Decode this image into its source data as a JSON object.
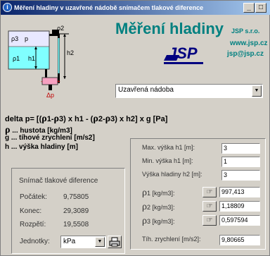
{
  "window": {
    "title": "Měření hladiny v uzavřené nádobě snímačem tlakové diference",
    "icon": "app-icon",
    "buttons": [
      "minimize-icon",
      "maximize-icon"
    ]
  },
  "diagram": {
    "labels": {
      "rho3": "ρ3",
      "p": "p",
      "rho1": "ρ1",
      "rho2": "ρ2",
      "h1": "h1",
      "h2": "h2",
      "minus": "-",
      "plus": "+",
      "delta_p": "Δp"
    }
  },
  "brand": {
    "title": "Měření hladiny",
    "company": "JSP s.r.o.",
    "web": "www.jsp.cz",
    "email": "jsp@jsp.cz",
    "logo": "JSP"
  },
  "vessel_select": {
    "value": "Uzavřená nádoba"
  },
  "formula": {
    "parts": [
      "delta p= [(",
      "1-",
      "3) x h1 - (",
      "2-",
      "3) x h2] x g  [Pa]"
    ],
    "rho_glyph": "ρ"
  },
  "legend": [
    {
      "sym": "ρ",
      "text": "... hustota [kg/m3]"
    },
    {
      "sym": "g",
      "text": "... tíhové zrychlení [m/s2]"
    },
    {
      "sym": "h",
      "text": "... výška hladiny [m]"
    }
  ],
  "sensor": {
    "title": "Snímač tlakové diference",
    "rows": [
      {
        "label": "Počátek:",
        "value": "9,75805"
      },
      {
        "label": "Konec:",
        "value": "29,3089"
      },
      {
        "label": "Rozpětí:",
        "value": "19,5508"
      }
    ],
    "units_label": "Jednotky:",
    "units_value": "kPa"
  },
  "params": {
    "max_h1": {
      "label": "Max. výška h1 [m]:",
      "value": "3"
    },
    "min_h1": {
      "label": "Min. výška h1 [m]:",
      "value": "1"
    },
    "h2": {
      "label": "Výška hladiny h2 [m]:",
      "value": "3"
    },
    "rho1": {
      "label": "1 [kg/m3]:",
      "value": "997,413"
    },
    "rho2": {
      "label": "2 [kg/m3]:",
      "value": "1,18809"
    },
    "rho3": {
      "label": "3 [kg/m3]:",
      "value": "0,597594"
    },
    "g": {
      "label": "Tíh. zrychlení [m/s2]:",
      "value": "9,80665"
    }
  },
  "colors": {
    "brand": "#008080",
    "face": "#d4d0c8",
    "liquid": "#80ffff",
    "titlebar": "#0a246a"
  }
}
